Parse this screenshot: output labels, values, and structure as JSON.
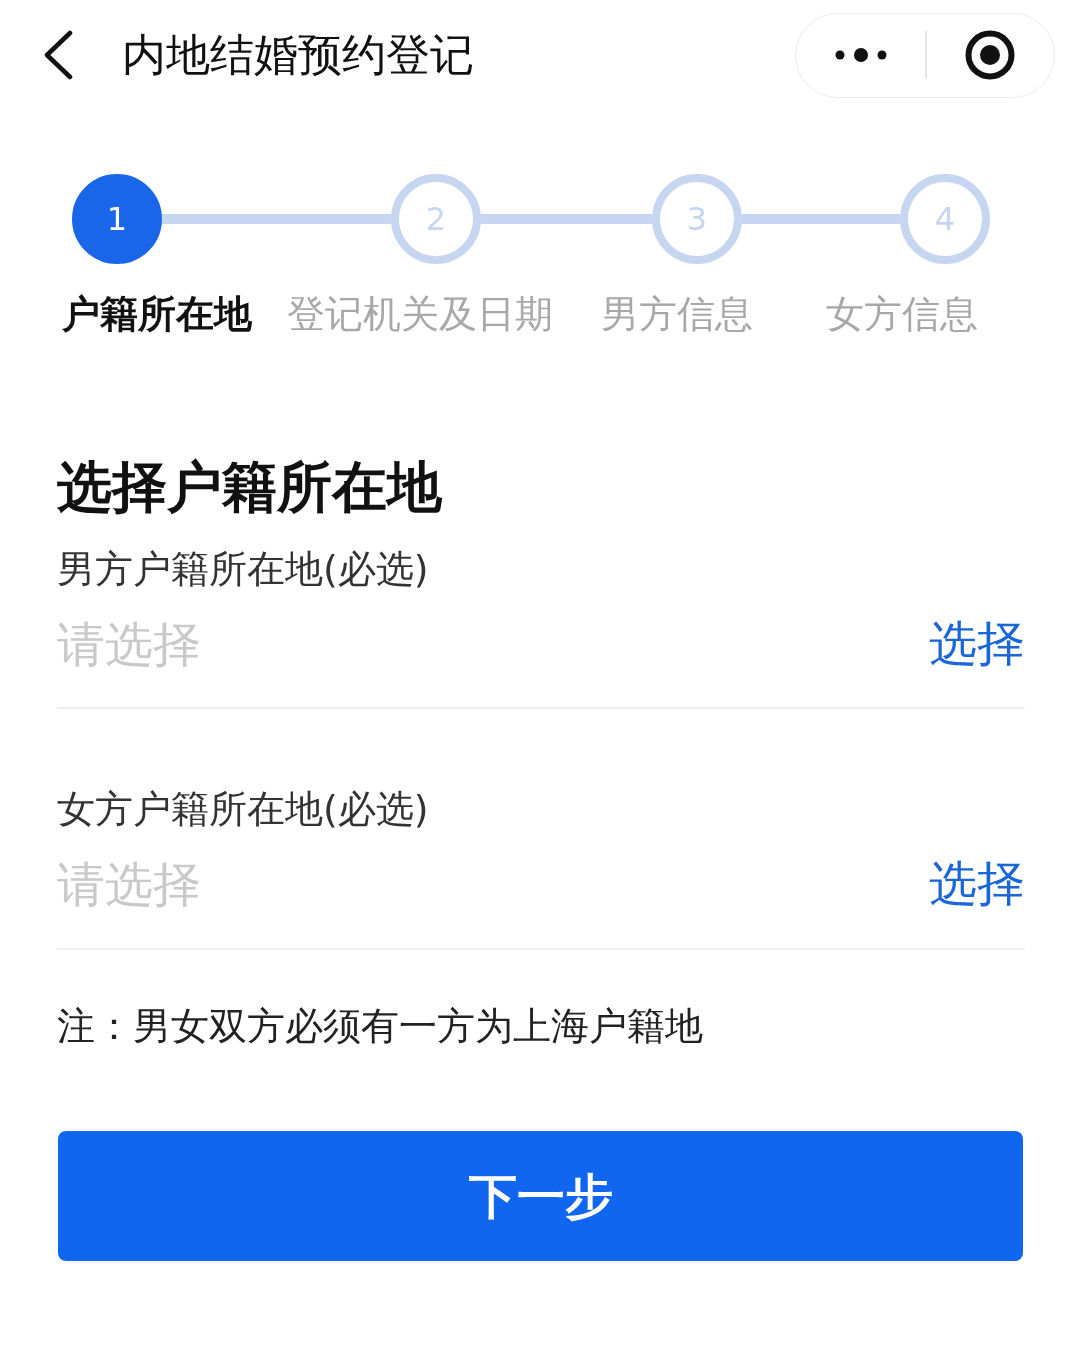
{
  "header": {
    "title": "内地结婚预约登记"
  },
  "steps": [
    {
      "number": "1",
      "label": "户籍所在地",
      "current": true
    },
    {
      "number": "2",
      "label": "登记机关及日期",
      "current": false
    },
    {
      "number": "3",
      "label": "男方信息",
      "current": false
    },
    {
      "number": "4",
      "label": "女方信息",
      "current": false
    }
  ],
  "section_title": "选择户籍所在地",
  "fields": [
    {
      "label": "男方户籍所在地(必选)",
      "placeholder": "请选择",
      "action": "选择"
    },
    {
      "label": "女方户籍所在地(必选)",
      "placeholder": "请选择",
      "action": "选择"
    }
  ],
  "note": "注：男女双方必须有一方为上海户籍地",
  "next_button": "下一步"
}
